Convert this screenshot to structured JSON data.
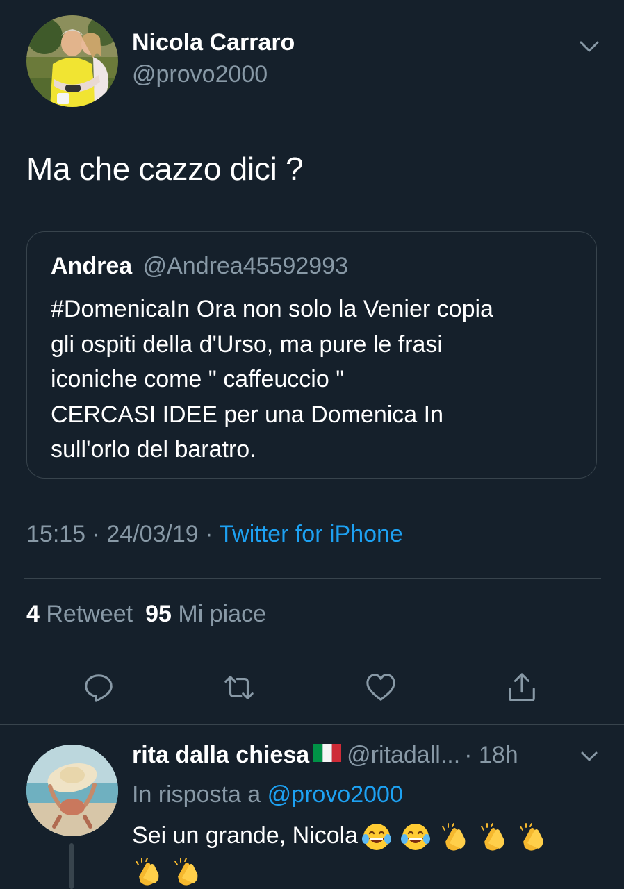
{
  "tweet": {
    "author_name": "Nicola Carraro",
    "author_handle": "@provo2000",
    "text": "Ma che cazzo dici ?",
    "avatar_icon": "profile-photo-avatar",
    "menu_icon": "chevron-down-icon"
  },
  "quote": {
    "name": "Andrea",
    "handle": "@Andrea45592993",
    "lines": [
      "#DomenicaIn Ora non solo la Venier copia",
      "gli ospiti della d'Urso, ma pure le frasi",
      "iconiche come \" caffeuccio \"",
      "CERCASI IDEE per una Domenica In",
      "sull'orlo del baratro."
    ]
  },
  "meta": {
    "time": "15:15",
    "separator": " · ",
    "date": "24/03/19",
    "separator2": " · ",
    "source": "Twitter for iPhone"
  },
  "stats": {
    "retweet_count": "4",
    "retweet_label": "Retweet",
    "like_count": "95",
    "like_label": "Mi piace"
  },
  "actions": [
    {
      "name": "reply",
      "icon": "reply-bubble-icon"
    },
    {
      "name": "retweet",
      "icon": "retweet-icon"
    },
    {
      "name": "like",
      "icon": "heart-icon"
    },
    {
      "name": "share",
      "icon": "share-icon"
    }
  ],
  "reply": {
    "name": "rita dalla chiesa",
    "flag": "italy-flag-emoji",
    "handle": "@ritadall...",
    "time": "· 18h",
    "in_reply_prefix": "In risposta a",
    "in_reply_mention": "@provo2000",
    "text": "Sei un grande, Nicola",
    "emojis": [
      "laughing-tears-emoji",
      "laughing-tears-emoji",
      "clapping-hands-emoji",
      "clapping-hands-emoji",
      "clapping-hands-emoji",
      "clapping-hands-emoji",
      "clapping-hands-emoji"
    ]
  },
  "colors": {
    "background": "#15202b",
    "text_primary": "#ffffff",
    "text_secondary": "#8899a6",
    "accent": "#1da1f2",
    "border": "#38444d"
  }
}
